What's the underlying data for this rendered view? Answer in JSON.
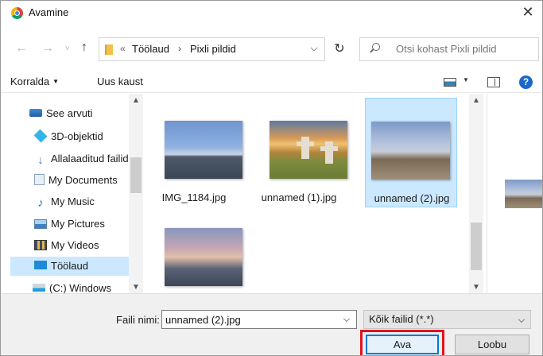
{
  "window": {
    "title": "Avamine"
  },
  "nav": {
    "path_separator": "«",
    "crumbs": [
      "Töölaud",
      "Pixli pildid"
    ],
    "search_placeholder": "Otsi kohast Pixli pildid"
  },
  "commandbar": {
    "organize": "Korralda",
    "new_folder": "Uus kaust"
  },
  "tree": {
    "items": [
      {
        "label": "See arvuti",
        "icon": "computer-icon"
      },
      {
        "label": "3D-objektid",
        "icon": "cube-icon"
      },
      {
        "label": "Allalaaditud failid",
        "icon": "download-icon"
      },
      {
        "label": "My Documents",
        "icon": "document-icon"
      },
      {
        "label": "My Music",
        "icon": "music-icon"
      },
      {
        "label": "My Pictures",
        "icon": "pictures-icon"
      },
      {
        "label": "My Videos",
        "icon": "video-icon"
      },
      {
        "label": "Töölaud",
        "icon": "desktop-icon",
        "selected": true
      },
      {
        "label": "(C:) Windows",
        "icon": "drive-icon"
      }
    ]
  },
  "files": [
    {
      "name": "IMG_1184.jpg"
    },
    {
      "name": "unnamed (1).jpg"
    },
    {
      "name": "unnamed (2).jpg",
      "selected": true
    },
    {
      "name": ""
    }
  ],
  "bottom": {
    "filename_label": "Faili nimi:",
    "filename_value": "unnamed (2).jpg",
    "filter_value": "Kõik failid (*.*)",
    "open_button": "Ava",
    "cancel_button": "Loobu"
  },
  "colors": {
    "selection": "#cce8ff",
    "highlight_border": "#e0141c",
    "accent": "#0078d7"
  }
}
